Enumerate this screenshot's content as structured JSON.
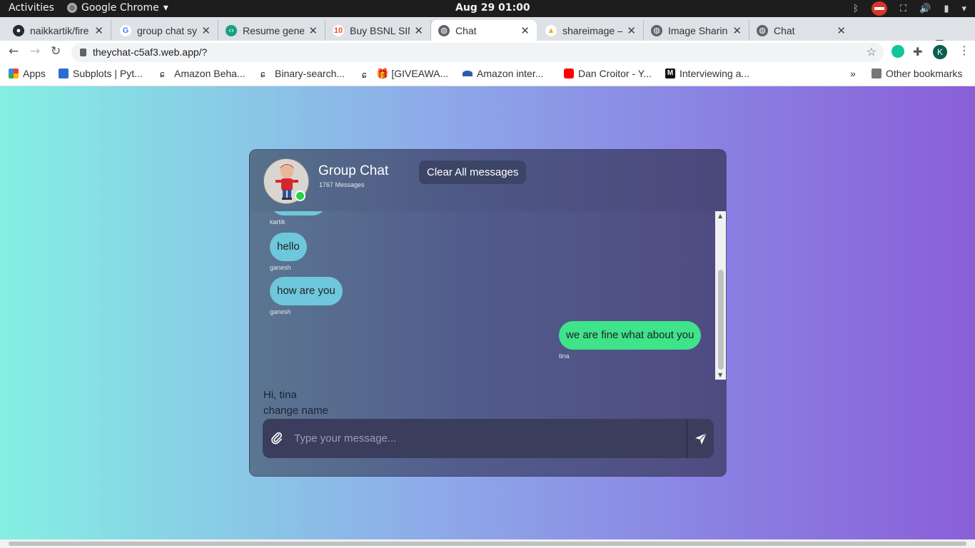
{
  "system": {
    "activities": "Activities",
    "app_name": "Google Chrome",
    "clock": "Aug 29  01:00"
  },
  "tabs": [
    {
      "title": "naikkartik/fire",
      "icon": "github-icon"
    },
    {
      "title": "group chat sy",
      "icon": "google-icon"
    },
    {
      "title": "Resume gener",
      "icon": "resume-icon"
    },
    {
      "title": "Buy BSNL SIM",
      "icon": "bsnl-icon"
    },
    {
      "title": "Chat",
      "icon": "globe-icon"
    },
    {
      "title": "shareimage –",
      "icon": "firebase-icon"
    },
    {
      "title": "Image Sharing",
      "icon": "globe-icon"
    },
    {
      "title": "Chat",
      "icon": "globe-icon"
    }
  ],
  "address": {
    "url": "theychat-c5af3.web.app/?"
  },
  "profile_initial": "K",
  "bookmarks": {
    "items": [
      "Apps",
      "Subplots | Pyt...",
      "Amazon Beha...",
      "Binary-search...",
      "🎁 [GIVEAWA...",
      "Amazon inter...",
      "Dan Croitor - Y...",
      "Interviewing a..."
    ],
    "overflow": "»",
    "other": "Other bookmarks"
  },
  "chat": {
    "title": "Group Chat",
    "message_count": "1767 Messages",
    "clear_label": "Clear All messages",
    "messages": [
      {
        "sender": "kartik",
        "text": ""
      },
      {
        "sender": "ganesh",
        "text": "hello"
      },
      {
        "sender": "ganesh",
        "text": "how are you"
      },
      {
        "sender": "tina",
        "text": "we are fine what about you"
      }
    ],
    "greeting": "Hi, tina",
    "change_name": "change name",
    "input_placeholder": "Type your message...",
    "colors": {
      "incoming": "#6ec7dd",
      "outgoing": "#3ee38a",
      "online": "#25d340"
    }
  }
}
